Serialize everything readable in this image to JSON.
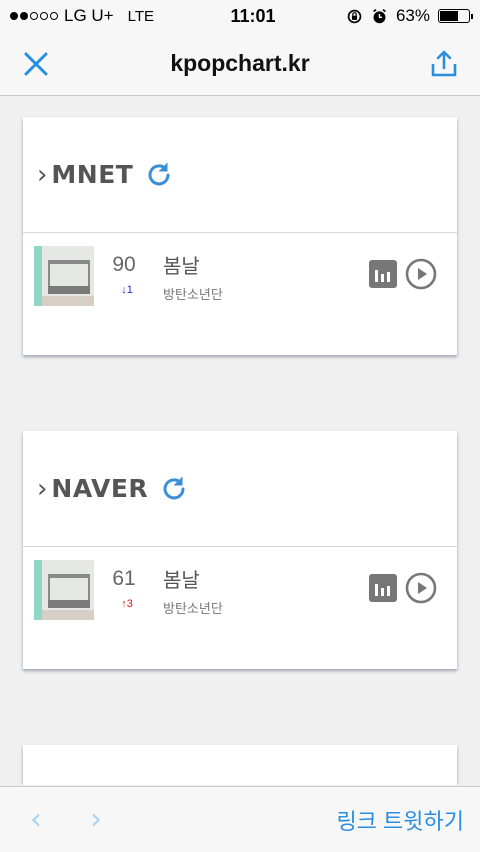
{
  "status_bar": {
    "carrier": "LG U+",
    "network": "LTE",
    "time": "11:01",
    "battery": "63%",
    "battery_level": 0.63
  },
  "navbar": {
    "title": "kpopchart.kr",
    "close_icon": "close-icon",
    "share_icon": "share-icon",
    "accent_color": "#2a8ee0"
  },
  "charts": [
    {
      "name": "MNET",
      "entry": {
        "rank": "90",
        "change": "↓1",
        "direction": "down",
        "song": "봄날",
        "artist": "방탄소년단"
      }
    },
    {
      "name": "NAVER",
      "entry": {
        "rank": "61",
        "change": "↑3",
        "direction": "up",
        "song": "봄날",
        "artist": "방탄소년단"
      }
    }
  ],
  "bottom_bar": {
    "back": "‹",
    "forward": "›",
    "tweet": "링크 트윗하기"
  }
}
